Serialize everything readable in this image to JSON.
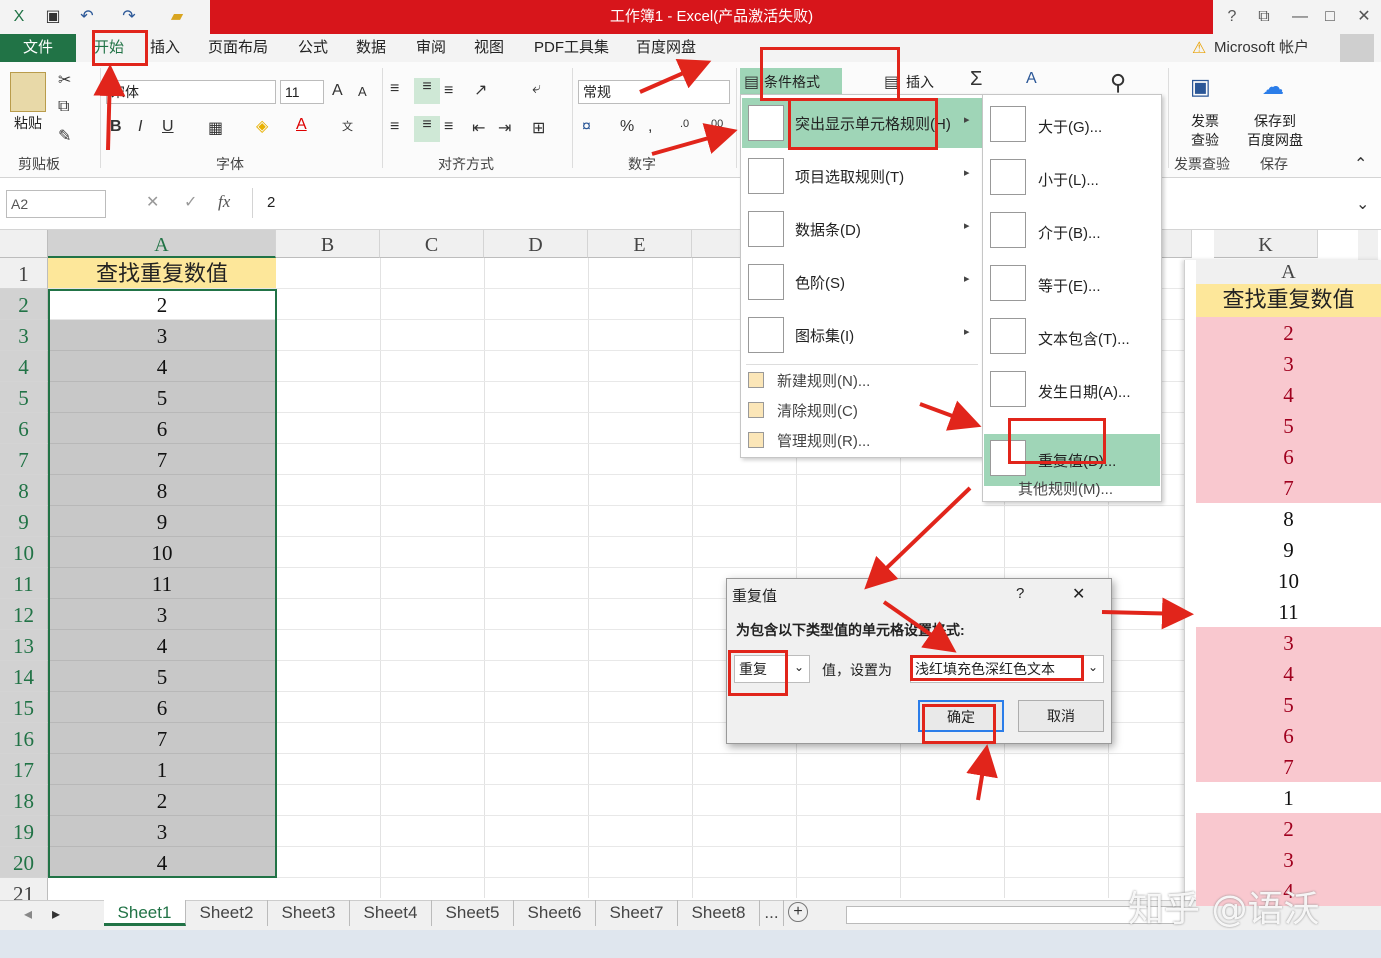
{
  "window": {
    "title": "工作簿1 - Excel(产品激活失败)",
    "help": "?",
    "account": "Microsoft 帐户"
  },
  "ribbon_tabs": [
    "文件",
    "开始",
    "插入",
    "页面布局",
    "公式",
    "数据",
    "审阅",
    "视图",
    "PDF工具集",
    "百度网盘"
  ],
  "ribbon": {
    "paste_label": "粘贴",
    "font_name": "宋体",
    "font_size": "11",
    "number_format": "常规",
    "conditional_format_label": "条件格式",
    "insert_label": "插入",
    "invoice_label": "发票\n查验",
    "baidu_save_label": "保存到\n百度网盘",
    "groups": {
      "clipboard": "剪贴板",
      "font": "字体",
      "alignment": "对齐方式",
      "number": "数字",
      "invoice": "发票查验",
      "save": "保存"
    }
  },
  "formula_bar": {
    "name_box": "A2",
    "fx": "fx",
    "value": "2"
  },
  "sheet": {
    "columns": [
      "A",
      "B",
      "C",
      "D",
      "E"
    ],
    "far_column": "K",
    "header_cell": "查找重复数值",
    "row_numbers": [
      "1",
      "2",
      "3",
      "4",
      "5",
      "6",
      "7",
      "8",
      "9",
      "10",
      "11",
      "12",
      "13",
      "14",
      "15",
      "16",
      "17",
      "18",
      "19",
      "20",
      "21"
    ],
    "values": [
      "2",
      "3",
      "4",
      "5",
      "6",
      "7",
      "8",
      "9",
      "10",
      "11",
      "3",
      "4",
      "5",
      "6",
      "7",
      "1",
      "2",
      "3",
      "4"
    ]
  },
  "cond_menu": {
    "items": [
      {
        "label": "突出显示单元格规则(H)",
        "highlighted": true
      },
      {
        "label": "项目选取规则(T)"
      },
      {
        "label": "数据条(D)"
      },
      {
        "label": "色阶(S)"
      },
      {
        "label": "图标集(I)"
      }
    ],
    "small_items": [
      "新建规则(N)...",
      "清除规则(C)",
      "管理规则(R)..."
    ]
  },
  "highlight_submenu": {
    "items": [
      "大于(G)...",
      "小于(L)...",
      "介于(B)...",
      "等于(E)...",
      "文本包含(T)...",
      "发生日期(A)...",
      "重复值(D)..."
    ],
    "other": "其他规则(M)..."
  },
  "dialog": {
    "title": "重复值",
    "help": "?",
    "close": "✕",
    "prompt": "为包含以下类型值的单元格设置格式:",
    "type_value": "重复",
    "set_as_label": "值，设置为",
    "format_value": "浅红填充色深红色文本",
    "ok": "确定",
    "cancel": "取消"
  },
  "preview": {
    "col": "A",
    "header": "查找重复数值",
    "cells": [
      {
        "v": "2",
        "dup": true
      },
      {
        "v": "3",
        "dup": true
      },
      {
        "v": "4",
        "dup": true
      },
      {
        "v": "5",
        "dup": true
      },
      {
        "v": "6",
        "dup": true
      },
      {
        "v": "7",
        "dup": true
      },
      {
        "v": "8",
        "dup": false
      },
      {
        "v": "9",
        "dup": false
      },
      {
        "v": "10",
        "dup": false
      },
      {
        "v": "11",
        "dup": false
      },
      {
        "v": "3",
        "dup": true
      },
      {
        "v": "4",
        "dup": true
      },
      {
        "v": "5",
        "dup": true
      },
      {
        "v": "6",
        "dup": true
      },
      {
        "v": "7",
        "dup": true
      },
      {
        "v": "1",
        "dup": false
      },
      {
        "v": "2",
        "dup": true
      },
      {
        "v": "3",
        "dup": true
      },
      {
        "v": "4",
        "dup": true
      }
    ]
  },
  "sheet_tabs": [
    "Sheet1",
    "Sheet2",
    "Sheet3",
    "Sheet4",
    "Sheet5",
    "Sheet6",
    "Sheet7",
    "Sheet8",
    "..."
  ],
  "watermark": "知乎 @语沃",
  "colors": {
    "excel_green": "#217346",
    "title_red": "#d7151b",
    "menu_highlight": "#9fd5b7",
    "dup_fill": "#f9c8cf",
    "dup_text": "#a0001e",
    "annotation_red": "#e1251b",
    "header_yellow": "#fde79a",
    "selection_gray": "#c8c8c8"
  }
}
